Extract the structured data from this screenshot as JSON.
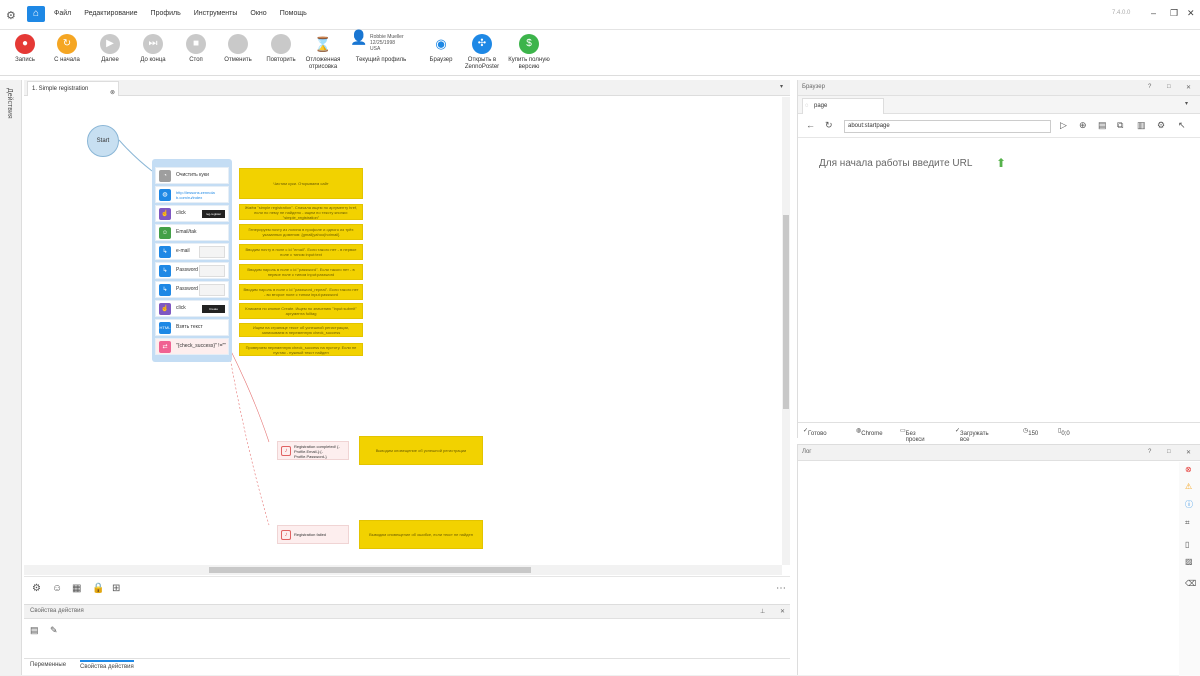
{
  "menubar": {
    "items": [
      "Файл",
      "Редактирование",
      "Профиль",
      "Инструменты",
      "Окно",
      "Помощь"
    ],
    "version": "7.4.0.0"
  },
  "toolbar": {
    "buttons": [
      {
        "label": "Запись",
        "color": "#e53935"
      },
      {
        "label": "С начала",
        "color": "#f5a623"
      },
      {
        "label": "Далее",
        "color": "#c9c9c9"
      },
      {
        "label": "До конца",
        "color": "#c9c9c9"
      },
      {
        "label": "Стоп",
        "color": "#c9c9c9"
      },
      {
        "label": "Отменить",
        "color": "#c9c9c9"
      },
      {
        "label": "Повторить",
        "color": "#c9c9c9"
      },
      {
        "label": "Отложенная отрисовка"
      },
      {
        "label": "Текущий профиль"
      },
      {
        "label": "Браузер"
      },
      {
        "label": "Открыть в ZennoPoster",
        "color": "#1e88e5"
      },
      {
        "label": "Купить полную версию",
        "color": "#3cb44b"
      }
    ],
    "profile": {
      "name": "Robbie Mueller",
      "date": "12/25/1998",
      "country": "USA"
    }
  },
  "sidestrip": {
    "label": "Действия"
  },
  "project_tab": {
    "label": "1. Simple registration"
  },
  "canvas": {
    "start": "Start",
    "actions": [
      {
        "label": "Очистить куки",
        "icon": "cookie-icon",
        "color": "#9e9e9e"
      },
      {
        "label": "http://lessons.zennola b.com/ru/index",
        "icon": "globe-icon",
        "color": "#1e88e5"
      },
      {
        "label": "click",
        "icon": "click-icon",
        "color": "#7e57c2",
        "thumb": "reg-register"
      },
      {
        "label": "Email/tak",
        "icon": "person-icon",
        "color": "#43a047"
      },
      {
        "label": "e-mail",
        "icon": "set-value-icon",
        "color": "#1e88e5"
      },
      {
        "label": "Password",
        "icon": "set-value-icon",
        "color": "#1e88e5"
      },
      {
        "label": "Password",
        "icon": "set-value-icon",
        "color": "#1e88e5"
      },
      {
        "label": "click",
        "icon": "click-icon",
        "color": "#7e57c2",
        "thumb": "Create"
      },
      {
        "label": "Взять текст",
        "icon": "html-icon",
        "color": "#1e88e5"
      },
      {
        "label": "\"{check_success}\" !=\"\"",
        "icon": "if-icon",
        "color": "#f06292"
      }
    ],
    "notes": [
      "Чистим куки. Открываем сайт",
      "Жмём \"simple registration\". Сначала ищем по аргументу href, если по нему не найдено - ищем по тексту кнопки: \"simple_registration\"",
      "Генерируем почту из логина в профиле и одного из трёх указанных доменов: {gmail|yahoo|hotmail}",
      "Вводим почту в поле с id \"email\". Если такого нет - в первое поле с типом input:text",
      "Вводим пароль в поле с id \"password\". Если такого нет - в первое поле с типом input:password",
      "Вводим пароль в поле с id \"password_repeat\". Если такого нет - во второе поле с типом input:password",
      "Кликаем по кнопке Create. Ищем по значению \"input:submit\" аргумента fulltag",
      "Ищем на странице текст об успешной регистрации, записываем в переменную check_success",
      "Проверяем переменную check_success на пустоту. Если не пустая - нужный текст найден"
    ],
    "notif_success": {
      "label": "Registration completed! {-Profile.Email-}:{-Profile.Password-}",
      "note": "Выводим оповещение об успешной регистрации"
    },
    "notif_fail": {
      "label": "Registration failed",
      "note": "Выводим оповещение об ошибке, если текст не найден"
    }
  },
  "browser": {
    "title": "Браузер",
    "tab": "page",
    "url": "about:startpage",
    "hint": "Для начала работы введите URL",
    "status": {
      "ready": "Готово",
      "engine": "Chrome",
      "proxy": "Без прокси",
      "load": "Загружать все",
      "timeout": "150",
      "coords": "0;0"
    }
  },
  "log": {
    "title": "Лог"
  },
  "props": {
    "title": "Свойства действия",
    "tabs": [
      "Переменные",
      "Свойства действия"
    ]
  }
}
